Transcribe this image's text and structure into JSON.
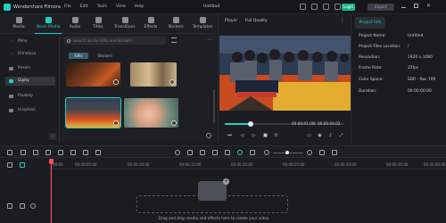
{
  "app": {
    "name": "Wondershare Filmora",
    "menu": [
      "File",
      "Edit",
      "Tools",
      "View",
      "Help"
    ],
    "project_title": "Untitled",
    "login_label": "Login",
    "export_label": "Export"
  },
  "media_tabs": [
    {
      "label": "Media",
      "icon": "media-icon"
    },
    {
      "label": "Stock Media",
      "icon": "stock-media-icon"
    },
    {
      "label": "Audio",
      "icon": "audio-icon"
    },
    {
      "label": "Titles",
      "icon": "titles-icon"
    },
    {
      "label": "Transitions",
      "icon": "transitions-icon"
    },
    {
      "label": "Effects",
      "icon": "effects-icon"
    },
    {
      "label": "Stickers",
      "icon": "stickers-icon"
    },
    {
      "label": "Templates",
      "icon": "templates-icon"
    }
  ],
  "sidebar": {
    "items": [
      {
        "label": "Mine",
        "icon": "chevron-right-icon"
      },
      {
        "label": "Filmstock",
        "icon": "chevron-right-icon"
      },
      {
        "label": "Pexels",
        "icon": "pexels-icon"
      },
      {
        "label": "Giphy",
        "icon": "giphy-icon"
      },
      {
        "label": "Pixabay",
        "icon": "pixabay-icon"
      },
      {
        "label": "Unsplash",
        "icon": "unsplash-icon"
      }
    ]
  },
  "content": {
    "search_placeholder": "Search all the GIFs and Stickers",
    "chips": [
      "GIFs",
      "Stickers"
    ]
  },
  "player": {
    "label": "Player",
    "quality": "Full Quality",
    "current_time": "00:00:01:00",
    "separator": "/",
    "total_time": "00:00:04:02",
    "progress_fraction": 0.22
  },
  "project_info": {
    "tab_label": "Project Info",
    "rows": [
      {
        "label": "Project Name:",
        "value": "Untitled"
      },
      {
        "label": "Project Files Location:",
        "value": "/"
      },
      {
        "label": "Resolution:",
        "value": "1920 x 1080"
      },
      {
        "label": "Frame Rate:",
        "value": "25fps"
      },
      {
        "label": "Color Space:",
        "value": "SDR - Rec.709"
      },
      {
        "label": "Duration:",
        "value": "00:00:00:00"
      }
    ]
  },
  "timeline": {
    "ruler": [
      "00:00",
      "00:00:05:00",
      "00:00:10:00",
      "00:00:15:00",
      "00:00:20:00",
      "00:00:25:00",
      "00:00:30:00",
      "00:00:35:00",
      "00:00:40:00"
    ],
    "drop_hint": "Drag and drop media and effects here to create your video."
  },
  "colors": {
    "accent": "#1fd0c0",
    "login_green": "#19b77f",
    "playhead": "#ff4d5a",
    "background": "#1b1c20"
  }
}
